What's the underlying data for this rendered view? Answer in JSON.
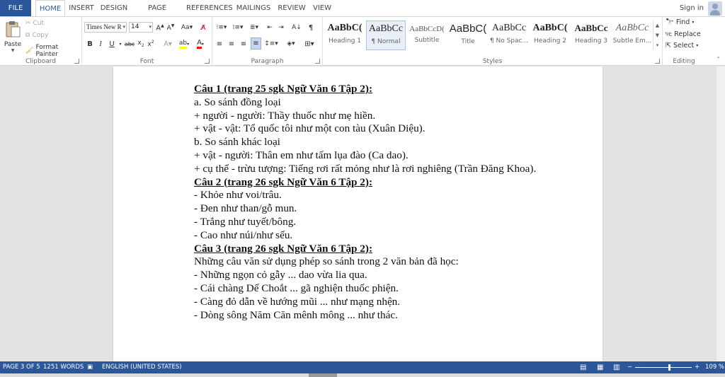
{
  "tabs": [
    "FILE",
    "HOME",
    "INSERT",
    "DESIGN",
    "PAGE LAYOUT",
    "REFERENCES",
    "MAILINGS",
    "REVIEW",
    "VIEW"
  ],
  "active_tab": "HOME",
  "sign_in": "Sign in",
  "clipboard": {
    "paste": "Paste",
    "cut": "Cut",
    "copy": "Copy",
    "format_painter": "Format Painter",
    "label": "Clipboard"
  },
  "font": {
    "name": "Times New R",
    "size": "14",
    "label": "Font"
  },
  "paragraph": {
    "label": "Paragraph"
  },
  "styles": {
    "label": "Styles",
    "items": [
      {
        "sample": "AaBbC(",
        "name": "Heading 1"
      },
      {
        "sample": "AaBbCc",
        "name": "¶ Normal"
      },
      {
        "sample": "AaBbCcD(",
        "name": "Subtitle"
      },
      {
        "sample": "AaBbC(",
        "name": "Title"
      },
      {
        "sample": "AaBbCc",
        "name": "¶ No Spac..."
      },
      {
        "sample": "AaBbC(",
        "name": "Heading 2"
      },
      {
        "sample": "AaBbCc",
        "name": "Heading 3"
      },
      {
        "sample": "AaBbCc",
        "name": "Subtle Em..."
      }
    ]
  },
  "editing": {
    "find": "Find",
    "replace": "Replace",
    "select": "Select",
    "label": "Editing"
  },
  "document": {
    "lines": [
      {
        "text": "Câu 1 (trang 25 sgk Ngữ Văn 6 Tập 2):",
        "style": "h"
      },
      {
        "text": "a. So sánh đồng loại",
        "style": "n"
      },
      {
        "text": "+ người - người: Thầy thuốc như mẹ hiền.",
        "style": "n"
      },
      {
        "text": "+ vật - vật: Tổ quốc tôi như một con tàu (Xuân Diệu).",
        "style": "n"
      },
      {
        "text": "b. So sánh khác loại",
        "style": "n"
      },
      {
        "text": "+ vật - người: Thân em như tấm lụa đào (Ca dao).",
        "style": "n"
      },
      {
        "text": "+ cụ thể - trừu tượng: Tiếng rơi rất mỏng như là rơi nghiêng (Trần Đăng Khoa).",
        "style": "n"
      },
      {
        "text": "Câu 2 (trang 26 sgk Ngữ Văn 6 Tập 2):",
        "style": "h"
      },
      {
        "text": "- Khỏe như voi/trâu.",
        "style": "n"
      },
      {
        "text": "- Đen như than/gỗ mun.",
        "style": "n"
      },
      {
        "text": "- Trắng như tuyết/bông.",
        "style": "n"
      },
      {
        "text": "- Cao như núi/như sếu.",
        "style": "n"
      },
      {
        "text": "Câu 3 (trang 26 sgk Ngữ Văn 6 Tập 2):",
        "style": "h"
      },
      {
        "text": "Những câu văn sử dụng phép so sánh trong 2 văn bản đã học:",
        "style": "n"
      },
      {
        "text": "- Những ngọn cỏ gẫy ... dao vừa lia qua.",
        "style": "n"
      },
      {
        "text": "- Cái chàng Dế Choắt ... gã nghiện thuốc phiện.",
        "style": "n"
      },
      {
        "text": "- Càng đỏ dẫn về hướng mũi ... như mạng nhện.",
        "style": "n"
      },
      {
        "text": "- Dòng sông Năm Căn mênh mông ... như thác.",
        "style": "n"
      }
    ]
  },
  "status": {
    "page": "PAGE 3 OF 5",
    "words": "1251 WORDS",
    "language": "ENGLISH (UNITED STATES)",
    "zoom": "109 %",
    "zoom_fraction": 0.6
  },
  "colors": {
    "brand": "#2b579a",
    "highlight": "#ffff00",
    "font_color": "#ff0000"
  }
}
